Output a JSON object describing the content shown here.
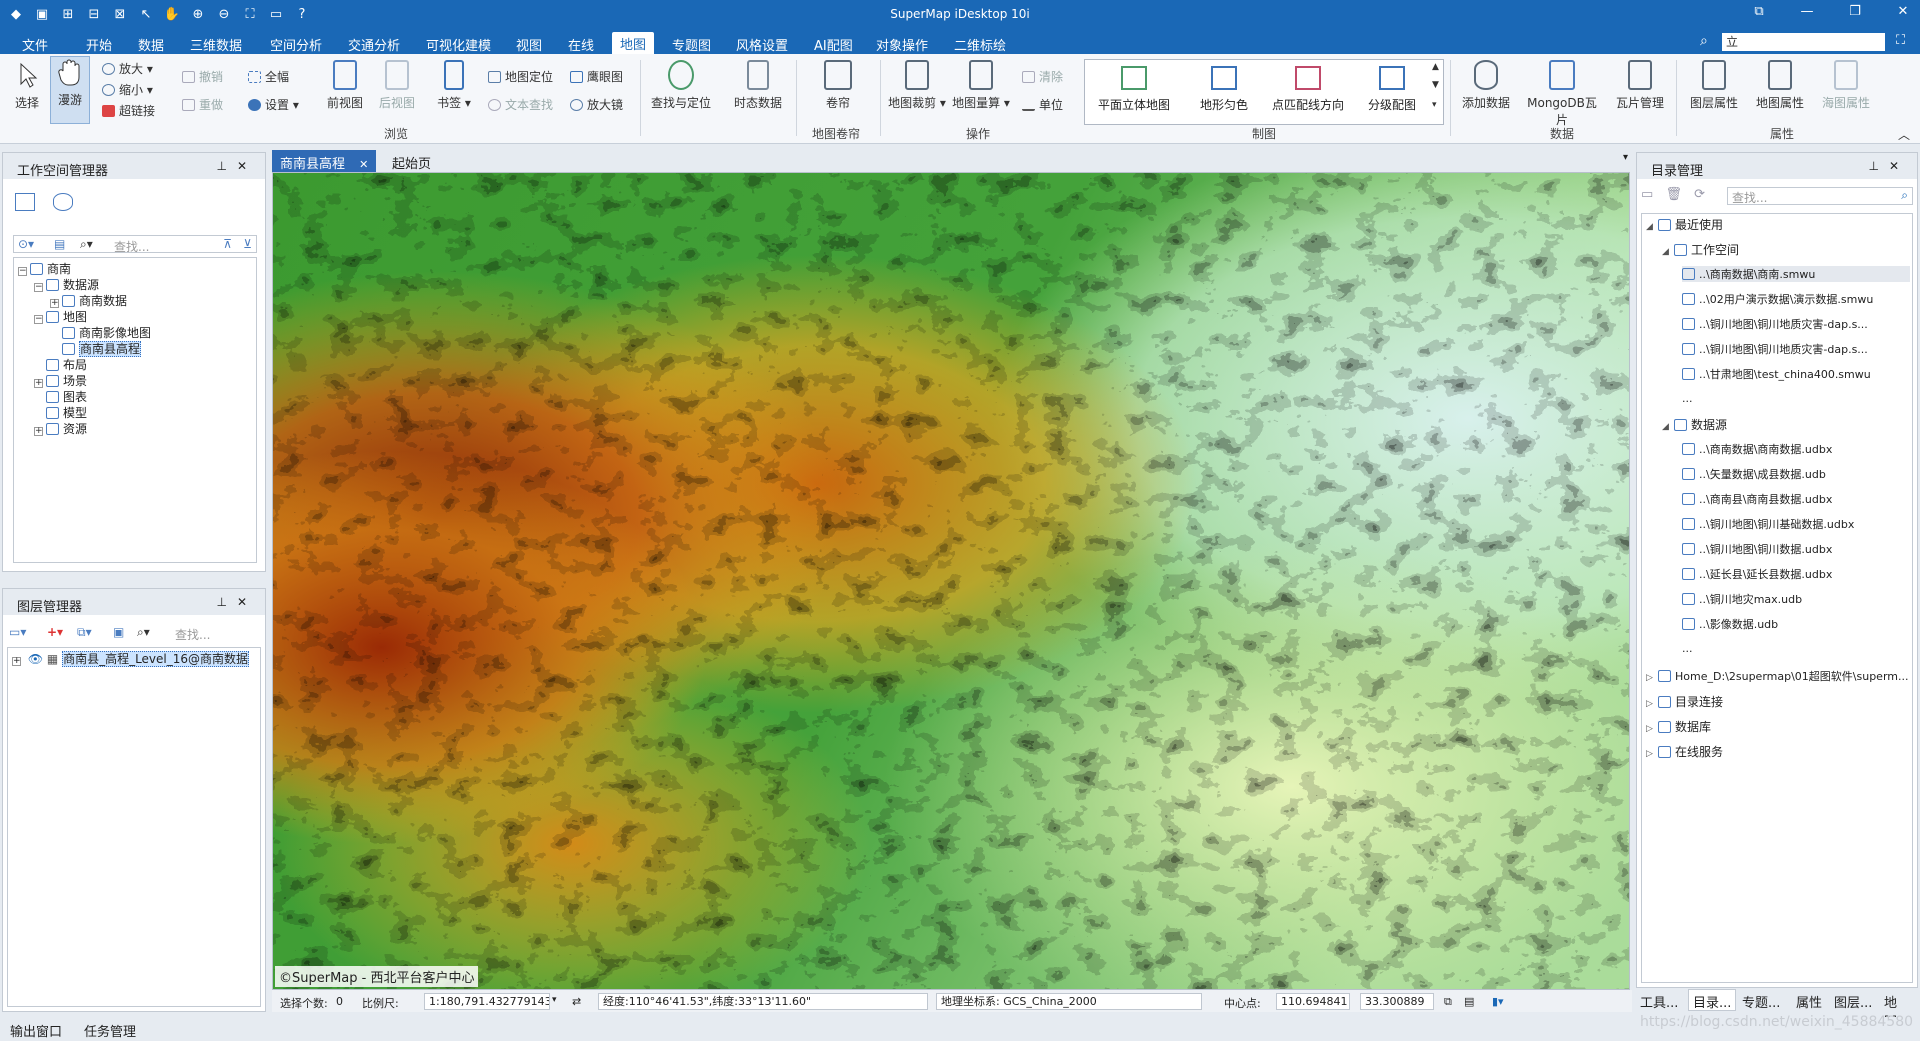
{
  "app": {
    "title": "SuperMap iDesktop 10i"
  },
  "menu": {
    "items": [
      "文件",
      "开始",
      "数据",
      "三维数据",
      "空间分析",
      "交通分析",
      "可视化建模",
      "视图",
      "在线",
      "地图",
      "专题图",
      "风格设置",
      "AI配图",
      "对象操作",
      "二维标绘"
    ],
    "active": "地图",
    "search_value": "立"
  },
  "ribbon": {
    "browse": {
      "select": "选择",
      "pan": "漫游",
      "zoom_in": "放大",
      "zoom_out": "缩小",
      "hyperlink": "超链接",
      "undo": "撤销",
      "redo": "重做",
      "full": "全幅",
      "settings": "设置",
      "prev_view": "前视图",
      "next_view": "后视图",
      "bookmark": "书签",
      "locate": "地图定位",
      "text_search": "文本查找",
      "eagle": "鹰眼图",
      "magnifier": "放大镜",
      "label": "浏览"
    },
    "query": {
      "find": "查找与定位",
      "temporal": "时态数据"
    },
    "swipe": {
      "swipe": "卷帘",
      "label": "地图卷帘"
    },
    "operate": {
      "clip": "地图裁剪",
      "measure": "地图量算",
      "clear": "清除",
      "unit": "单位",
      "label": "操作"
    },
    "cartography": {
      "items": [
        "平面立体地图",
        "地形匀色",
        "点匹配线方向",
        "分级配图"
      ],
      "label": "制图"
    },
    "data": {
      "add": "添加数据",
      "mongo": "MongoDB瓦片",
      "tiles": "瓦片管理",
      "label": "数据"
    },
    "props": {
      "layer_props": "图层属性",
      "map_props": "地图属性",
      "chart_props": "海图属性",
      "label": "属性"
    }
  },
  "workspace": {
    "title": "工作空间管理器",
    "search_placeholder": "查找...",
    "nodes": [
      "商南",
      "数据源",
      "商南数据",
      "地图",
      "商南影像地图",
      "商南县高程",
      "布局",
      "场景",
      "图表",
      "模型",
      "资源"
    ]
  },
  "layers": {
    "title": "图层管理器",
    "search_placeholder": "查找...",
    "layer": "商南县_高程_Level_16@商南数据"
  },
  "doc_tabs": {
    "active": "商南县高程",
    "other": "起始页"
  },
  "map": {
    "copyright": "©SuperMap - 西北平台客户中心"
  },
  "status": {
    "selected_label": "选择个数:",
    "selected": "0",
    "scale_label": "比例尺:",
    "scale": "1:180,791.432779143",
    "lonlat": "经度:110°46'41.53\",纬度:33°13'11.60\"",
    "crs": "地理坐标系: GCS_China_2000",
    "center_label": "中心点:",
    "cx": "110.694841",
    "cy": "33.300889"
  },
  "catalog": {
    "title": "目录管理",
    "search_placeholder": "查找...",
    "recent": "最近使用",
    "workspace": "工作空间",
    "ws_files": [
      "..\\商南数据\\商南.smwu",
      "..\\02用户演示数据\\演示数据.smwu",
      "..\\铜川地图\\铜川地质灾害-dap.s...",
      "..\\铜川地图\\铜川地质灾害-dap.s...",
      "..\\甘肃地图\\test_china400.smwu",
      "..."
    ],
    "datasource": "数据源",
    "ds_files": [
      "..\\商南数据\\商南数据.udbx",
      "..\\矢量数据\\成县数据.udb",
      "..\\商南县\\商南县数据.udbx",
      "..\\铜川地图\\铜川基础数据.udbx",
      "..\\铜川地图\\铜川数据.udbx",
      "..\\延长县\\延长县数据.udbx",
      "..\\铜川地灾max.udb",
      "..\\影像数据.udb",
      "..."
    ],
    "home": "Home_D:\\2supermap\\01超图软件\\superm...",
    "dir_conn": "目录连接",
    "database": "数据库",
    "online": "在线服务"
  },
  "right_tabs": [
    "工具...",
    "目录...",
    "专题...",
    "属性",
    "图层...",
    "地图..."
  ],
  "bottom": {
    "output": "输出窗口",
    "tasks": "任务管理"
  },
  "watermark": "https://blog.csdn.net/weixin_45884580",
  "colors": {
    "accent": "#1a68b6",
    "terrain": [
      "#a83a08",
      "#e8a318",
      "#2e8f2e",
      "#bfe6a8",
      "#d8f0ec"
    ]
  }
}
